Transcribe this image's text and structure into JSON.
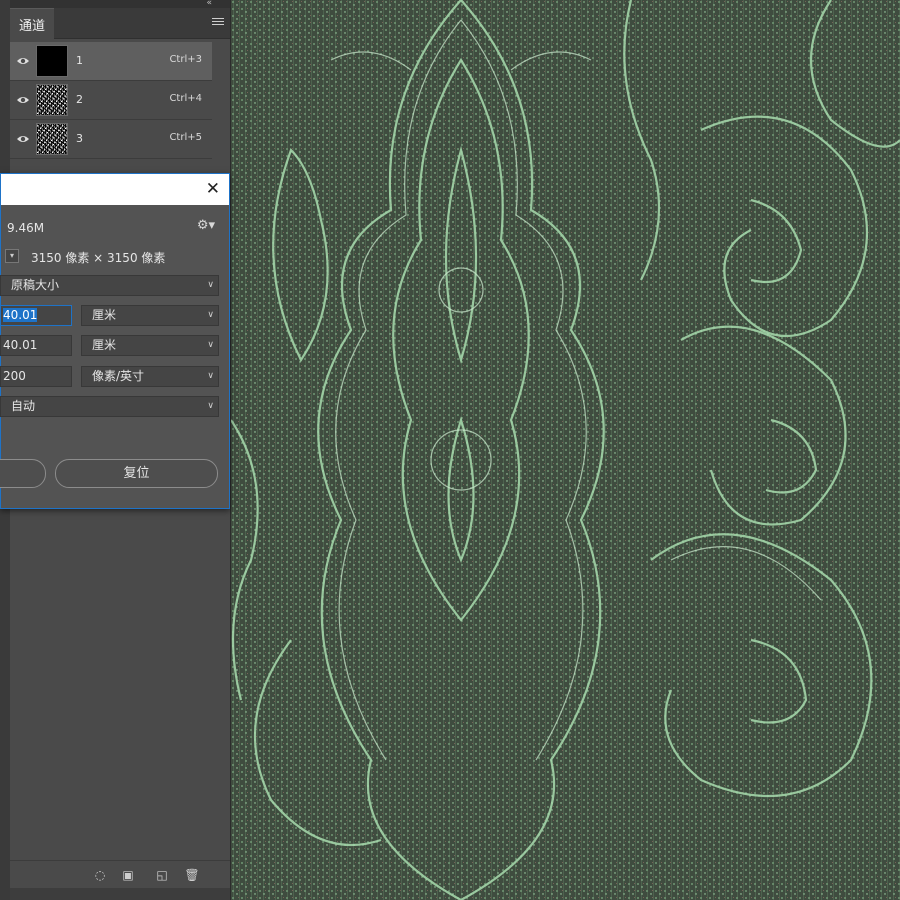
{
  "channels_panel": {
    "tab_label": "通道",
    "channels": [
      {
        "name": "1",
        "shortcut": "Ctrl+3",
        "visible": true,
        "selected": true,
        "thumbnail": "black"
      },
      {
        "name": "2",
        "shortcut": "Ctrl+4",
        "visible": true,
        "selected": false,
        "thumbnail": "noise"
      },
      {
        "name": "3",
        "shortcut": "Ctrl+5",
        "visible": true,
        "selected": false,
        "thumbnail": "noise"
      }
    ],
    "footer_icons": [
      "load-selection-icon",
      "save-selection-icon",
      "new-channel-icon",
      "delete-icon"
    ]
  },
  "dialog": {
    "close_glyph": "✕",
    "size": "9.46M",
    "dimensions": "3150 像素 × 3150 像素",
    "fit_to": "原稿大小",
    "width_value": "40.01",
    "width_unit": "厘米",
    "height_value": "40.01",
    "height_unit": "厘米",
    "resolution_value": "200",
    "resolution_unit": "像素/英寸",
    "resample": "自动",
    "reset_label": "复位"
  },
  "colors": {
    "panel_bg": "#4a4a4a",
    "selected_row": "#5f5f5f",
    "accent": "#1e73c8",
    "canvas_dark": "#3f4c3f",
    "canvas_pattern": "#a8dcae"
  }
}
